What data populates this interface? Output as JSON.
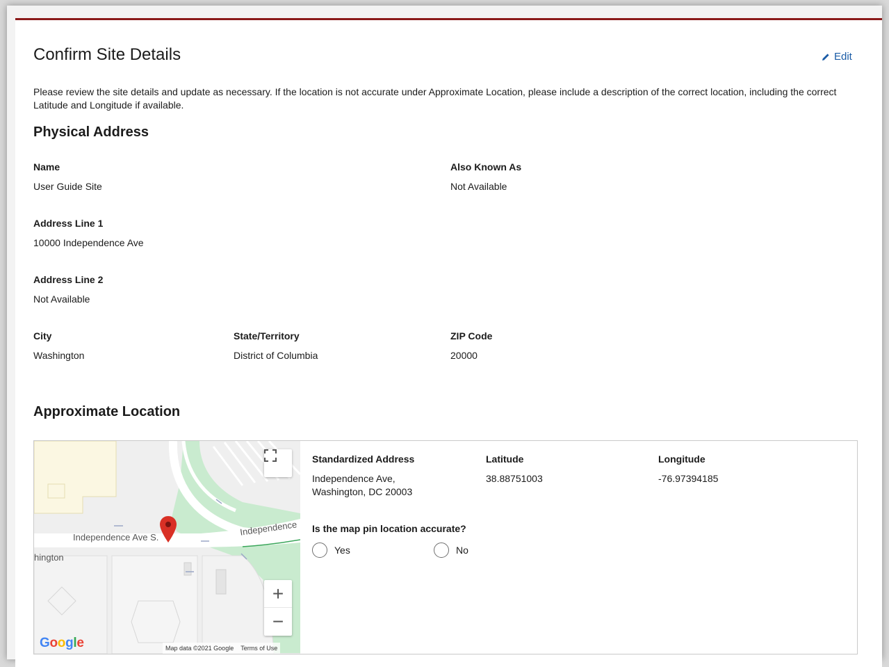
{
  "header": {
    "title": "Confirm Site Details",
    "edit_label": "Edit",
    "intro": "Please review the site details and update as necessary. If the location is not accurate under Approximate Location, please include a description of the correct location, including the correct Latitude and Longitude if available."
  },
  "physical_address": {
    "heading": "Physical Address",
    "fields": {
      "name": {
        "label": "Name",
        "value": "User Guide Site"
      },
      "aka": {
        "label": "Also Known As",
        "value": "Not Available"
      },
      "line1": {
        "label": "Address Line 1",
        "value": "10000 Independence Ave"
      },
      "line2": {
        "label": "Address Line 2",
        "value": "Not Available"
      },
      "city": {
        "label": "City",
        "value": "Washington"
      },
      "state": {
        "label": "State/Territory",
        "value": "District of Columbia"
      },
      "zip": {
        "label": "ZIP Code",
        "value": "20000"
      }
    }
  },
  "approx_location": {
    "heading": "Approximate Location",
    "standardized": {
      "label": "Standardized Address",
      "line1": "Independence Ave,",
      "line2": "Washington, DC 20003"
    },
    "latitude": {
      "label": "Latitude",
      "value": "38.88751003"
    },
    "longitude": {
      "label": "Longitude",
      "value": "-76.97394185"
    },
    "question": "Is the map pin location accurate?",
    "options": [
      "Yes",
      "No"
    ]
  },
  "map": {
    "street_label_1": "Independence Ave S.",
    "street_label_2": "Independence",
    "area_label": "hington",
    "zoom_in": "+",
    "zoom_out": "−",
    "attribution": "Map data ©2021 Google",
    "terms": "Terms of Use",
    "logo_letters": [
      "G",
      "o",
      "o",
      "g",
      "l",
      "e"
    ]
  },
  "colors": {
    "accent_border": "#8b1a1a",
    "link": "#1a5ba6",
    "pin": "#d93025",
    "park": "#bfe6c6"
  }
}
